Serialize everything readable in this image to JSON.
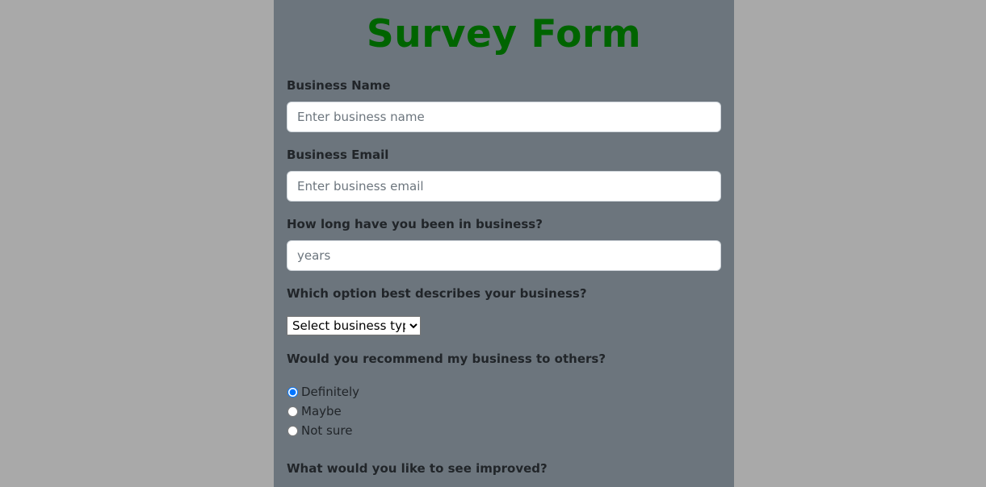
{
  "page": {
    "title": "Survey Form"
  },
  "fields": {
    "business_name": {
      "label": "Business Name",
      "placeholder": "Enter business name",
      "value": ""
    },
    "business_email": {
      "label": "Business Email",
      "placeholder": "Enter business email",
      "value": ""
    },
    "years_in_business": {
      "label": "How long have you been in business?",
      "placeholder": "years",
      "value": ""
    },
    "business_type": {
      "label": "Which option best describes your business?",
      "selected": "Select business type"
    },
    "recommend": {
      "label": "Would you recommend my business to others?",
      "options": [
        "Definitely",
        "Maybe",
        "Not sure"
      ],
      "selected": "Definitely"
    },
    "improvements": {
      "label": "What would you like to see improved?"
    }
  },
  "colors": {
    "page_background": "#a9a9a9",
    "panel_background": "#6c757d",
    "title": "#006400",
    "label_text": "#212529"
  }
}
